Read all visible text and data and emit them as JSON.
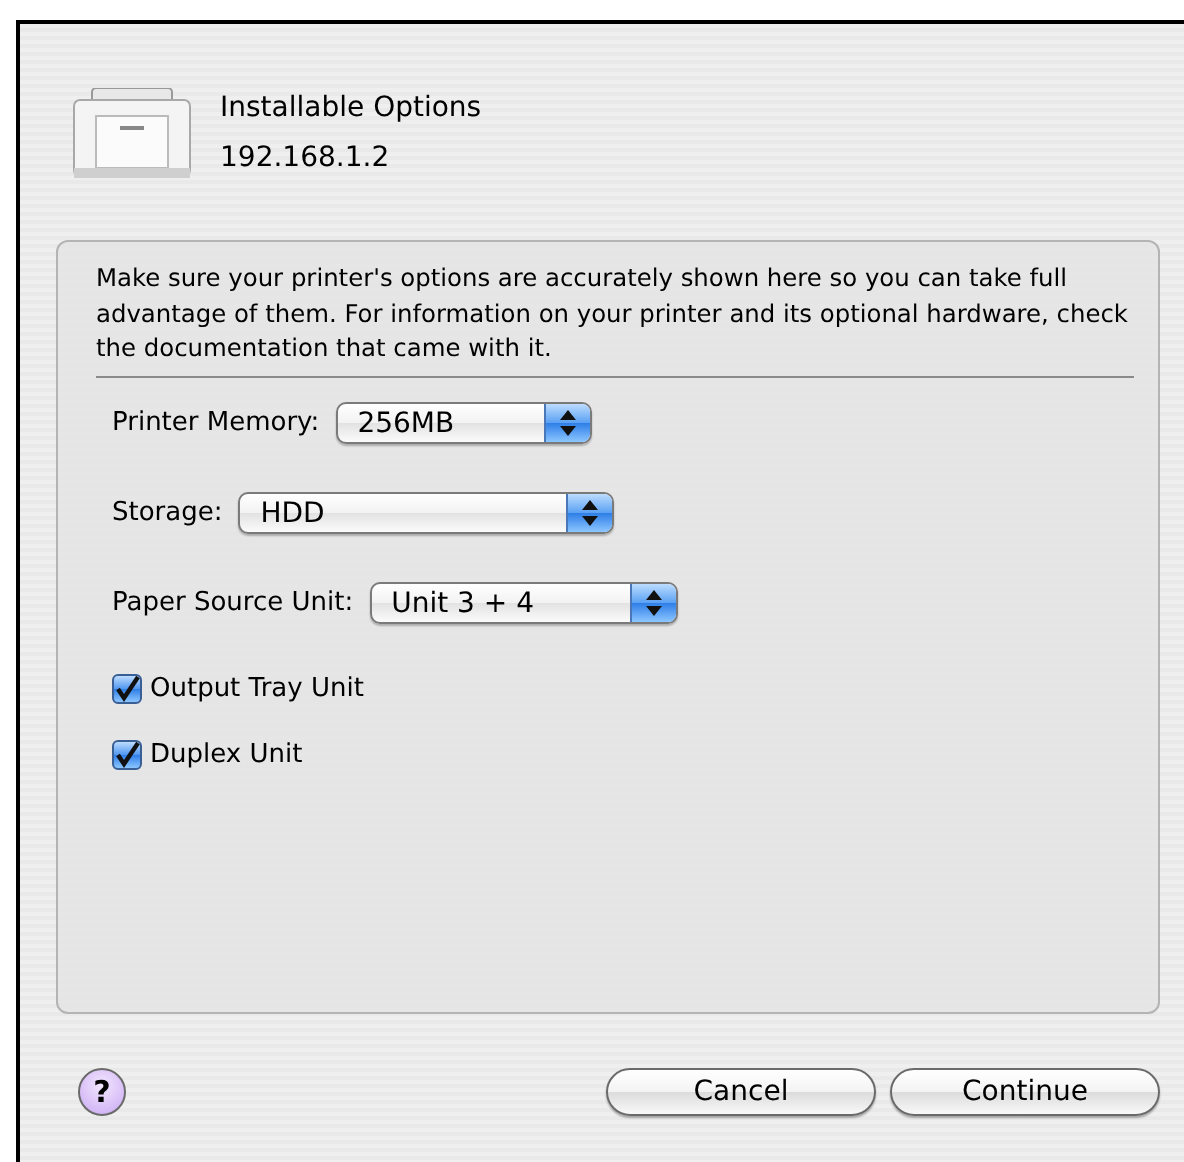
{
  "sheet": {
    "title": "Installable Options",
    "subtitle": "192.168.1.2"
  },
  "description": "Make sure your printer's options are accurately shown here so you can take full advantage of them.  For information on your printer and its optional hardware, check the documentation that came with it.",
  "options": [
    {
      "kind": "popup",
      "label": "Printer Memory:",
      "value": "256MB"
    },
    {
      "kind": "popup",
      "label": "Storage:",
      "value": "HDD"
    },
    {
      "kind": "popup",
      "label": "Paper Source Unit:",
      "value": "Unit 3 + 4"
    },
    {
      "kind": "checkbox",
      "label": "Output Tray Unit",
      "checked": true
    },
    {
      "kind": "checkbox",
      "label": "Duplex Unit",
      "checked": true
    }
  ],
  "help_button": {
    "label": "?"
  },
  "buttons": [
    "Cancel",
    "Continue"
  ]
}
